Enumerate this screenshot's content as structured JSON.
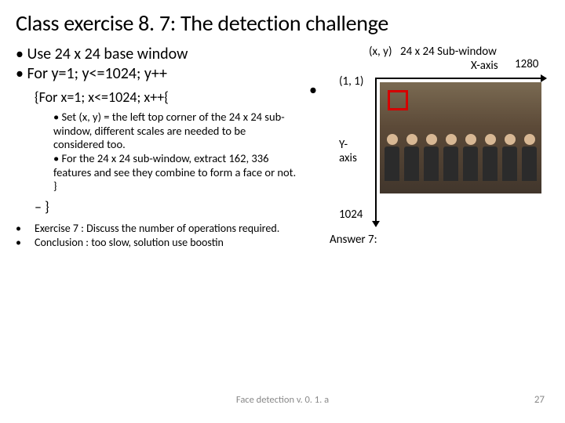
{
  "title": "Class exercise 8. 7: The detection challenge",
  "left": {
    "b1": "Use 24 x 24 base window",
    "b2": "For y=1; y<=1024; y++",
    "for_x": "{For x=1; x<=1024; x++{",
    "inner1": "Set (x, y) = the left top corner of the 24 x 24 sub-window, different scales are needed to be considered too.",
    "inner2": "For the 24 x 24 sub-window, extract 162, 336 features and see they combine to form a face or not. }",
    "dash_close": "– }",
    "ex7": "Exercise 7 : Discuss the number of operations required.",
    "concl": "Conclusion : too slow, solution use boostin"
  },
  "right": {
    "xy": "(x, y)",
    "subwin": "24 x 24 Sub-window",
    "xaxis": "X-axis",
    "n1280": "1280",
    "origin": "(1, 1)",
    "stray": "•",
    "yaxis1": "Y-",
    "yaxis2": "axis",
    "n1024": "1024",
    "answer": "Answer 7:"
  },
  "footer": "Face detection v. 0. 1. a",
  "pagenum": "27"
}
